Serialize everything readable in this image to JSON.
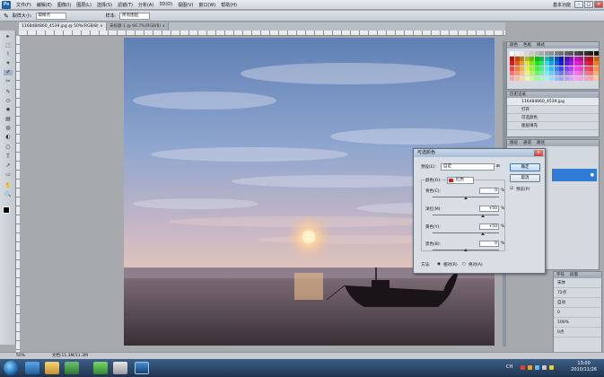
{
  "menu": {
    "logo": "Ps",
    "items": [
      "文件(F)",
      "编辑(E)",
      "图像(I)",
      "图层(L)",
      "选择(S)",
      "滤镜(T)",
      "分析(A)",
      "3D(D)",
      "视图(V)",
      "窗口(W)",
      "帮助(H)"
    ],
    "workspace": "基本功能",
    "window_buttons": [
      "–",
      "□",
      "×"
    ]
  },
  "options": {
    "size_label": "取样大小:",
    "size_value": "取样点",
    "sample_value": "所有图层",
    "ring_label": "样本:",
    "ring_value": "所有图层"
  },
  "tabs": [
    {
      "label": "1168484860_4539.jpg @ 50%(RGB/8) ×",
      "active": true
    },
    {
      "label": "未标题-1 @ 66.7%(RGB/8) ×",
      "active": false
    }
  ],
  "tools": [
    "▸",
    "⬚",
    "⌇",
    "✦",
    "✐",
    "✂",
    "✎",
    "⬭",
    "✸",
    "▤",
    "◍",
    "◐",
    "⎔",
    "T",
    "↗",
    "▭",
    "✋",
    "🔍"
  ],
  "panels": {
    "swatches_tabs": [
      "颜色",
      "色板",
      "样式"
    ],
    "history_title": "历史记录",
    "history_items": [
      "116484860_4539.jpg",
      "打开",
      "可选颜色",
      "图层填充"
    ],
    "layers_tabs": [
      "图层",
      "通道",
      "路径"
    ],
    "char_tabs": [
      "字符",
      "段落"
    ],
    "char_rows": [
      "宋体",
      "72点",
      "自动",
      "0",
      "100%",
      "0点"
    ]
  },
  "dialog": {
    "title": "可选颜色",
    "preset_label": "预设(E):",
    "preset_value": "自定",
    "colors_label": "颜色(O):",
    "colors_value": "红色",
    "cyan_label": "青色(C):",
    "cyan_value": "0",
    "magenta_label": "洋红(M):",
    "magenta_value": "+50",
    "yellow_label": "黄色(Y):",
    "yellow_value": "+50",
    "black_label": "黑色(B):",
    "black_value": "0",
    "percent": "%",
    "method_label": "方法:",
    "relative_label": "相对(R)",
    "absolute_label": "绝对(A)",
    "ok": "确定",
    "cancel": "取消",
    "preview": "预览(P)"
  },
  "status": {
    "zoom": "50%",
    "doc": "文档:11.3M/11.3M"
  },
  "taskbar": {
    "lang": "CH",
    "time": "13:00",
    "date": "2010/11/26"
  }
}
